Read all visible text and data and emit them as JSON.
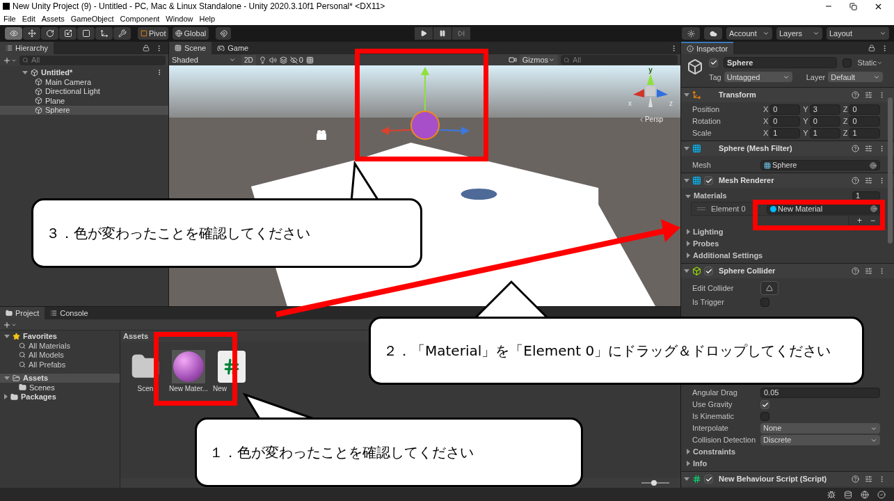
{
  "window": {
    "title": "New Unity Project (9) - Untitled - PC, Mac & Linux Standalone - Unity 2020.3.10f1 Personal* <DX11>"
  },
  "menu": [
    "File",
    "Edit",
    "Assets",
    "GameObject",
    "Component",
    "Window",
    "Help"
  ],
  "toolbar": {
    "tools": [
      {
        "kind": "view",
        "selected": true
      },
      {
        "kind": "move",
        "selected": false
      },
      {
        "kind": "rotate",
        "selected": false
      },
      {
        "kind": "scale",
        "selected": false
      },
      {
        "kind": "rect",
        "selected": false
      },
      {
        "kind": "transform",
        "selected": false
      },
      {
        "kind": "custom",
        "selected": false
      }
    ],
    "pivot": "Pivot",
    "global": "Global",
    "right": [
      "Account",
      "Layers",
      "Layout"
    ]
  },
  "hierarchy": {
    "title": "Hierarchy",
    "search_placeholder": "All",
    "scene": {
      "label": "Untitled*",
      "expanded": true,
      "children": [
        {
          "label": "Main Camera",
          "selected": false
        },
        {
          "label": "Directional Light",
          "selected": false
        },
        {
          "label": "Plane",
          "selected": false
        },
        {
          "label": "Sphere",
          "selected": true
        }
      ]
    }
  },
  "scene": {
    "tabs": [
      {
        "label": "Scene",
        "selected": true
      },
      {
        "label": "Game",
        "selected": false
      }
    ],
    "shading": "Shaded",
    "mode_2d": "2D",
    "hidden_count": "0",
    "gizmos": "Gizmos",
    "search_placeholder": "All",
    "axis_labels": [
      "y",
      "x",
      "z"
    ],
    "projection": "Persp"
  },
  "inspector": {
    "title": "Inspector",
    "active": true,
    "name": "Sphere",
    "static": false,
    "static_label": "Static",
    "tag_label": "Tag",
    "tag": "Untagged",
    "layer_label": "Layer",
    "layer": "Default",
    "components": [
      {
        "kind": "transform",
        "title": "Transform",
        "rows": [
          {
            "kind": "vector3",
            "label": "Position",
            "fields": [
              {
                "axis": "X",
                "value": "0"
              },
              {
                "axis": "Y",
                "value": "3"
              },
              {
                "axis": "Z",
                "value": "0"
              }
            ]
          },
          {
            "kind": "vector3",
            "label": "Rotation",
            "fields": [
              {
                "axis": "X",
                "value": "0"
              },
              {
                "axis": "Y",
                "value": "0"
              },
              {
                "axis": "Z",
                "value": "0"
              }
            ]
          },
          {
            "kind": "vector3",
            "label": "Scale",
            "fields": [
              {
                "axis": "X",
                "value": "1"
              },
              {
                "axis": "Y",
                "value": "1"
              },
              {
                "axis": "Z",
                "value": "1"
              }
            ]
          }
        ]
      },
      {
        "kind": "mesh",
        "title": "Sphere (Mesh Filter)",
        "rows": [
          {
            "kind": "object",
            "label": "Mesh",
            "value": "Sphere"
          }
        ]
      },
      {
        "kind": "renderer",
        "title": "Mesh Renderer",
        "enabled": true,
        "rows": [
          {
            "kind": "list",
            "label": "Materials",
            "count": "1"
          },
          {
            "kind": "element",
            "label": "Element 0",
            "value": "New Material",
            "add": "+",
            "remove": "−"
          },
          {
            "kind": "foldout",
            "label": "Lighting",
            "expanded": false
          },
          {
            "kind": "foldout",
            "label": "Probes",
            "expanded": false
          },
          {
            "kind": "foldout",
            "label": "Additional Settings",
            "expanded": false
          }
        ]
      },
      {
        "kind": "collider",
        "title": "Sphere Collider",
        "enabled": true,
        "rows": [
          {
            "kind": "button",
            "label": "Edit Collider"
          },
          {
            "kind": "checkbox",
            "label": "Is Trigger",
            "checked": false
          }
        ]
      },
      {
        "rows": [
          {
            "kind": "text",
            "label": "Angular Drag",
            "value": "0.05"
          },
          {
            "kind": "checkbox",
            "label": "Use Gravity",
            "checked": true
          },
          {
            "kind": "checkbox",
            "label": "Is Kinematic",
            "checked": false
          },
          {
            "kind": "dropdown",
            "label": "Interpolate",
            "value": "None"
          },
          {
            "kind": "dropdown",
            "label": "Collision Detection",
            "value": "Discrete"
          },
          {
            "kind": "foldout",
            "label": "Constraints",
            "expanded": false
          },
          {
            "kind": "foldout",
            "label": "Info",
            "expanded": false
          }
        ]
      },
      {
        "kind": "script",
        "title": "New Behaviour Script (Script)",
        "enabled": true
      }
    ]
  },
  "project": {
    "tabs": [
      {
        "label": "Project",
        "selected": true
      },
      {
        "label": "Console",
        "selected": false
      }
    ],
    "favorites": {
      "label": "Favorites",
      "expanded": true,
      "children": [
        "All Materials",
        "All Models",
        "All Prefabs"
      ]
    },
    "tree": [
      {
        "label": "Assets",
        "selected": true,
        "expanded": true,
        "children": [
          "Scenes"
        ]
      },
      {
        "label": "Packages",
        "selected": false,
        "expanded": false
      }
    ],
    "breadcrumb": "Assets",
    "items": [
      {
        "kind": "folder",
        "label": "Scen"
      },
      {
        "kind": "material",
        "label": "New Mater..."
      },
      {
        "kind": "script",
        "label": "New"
      }
    ],
    "zoom": {
      "level": 0.45
    }
  },
  "annotations": {
    "callouts": [
      "３．色が変わったことを確認してください",
      "２．「Material」を「Element 0」にドラッグ＆ドロップしてください",
      "１．色が変わったことを確認してください"
    ]
  }
}
